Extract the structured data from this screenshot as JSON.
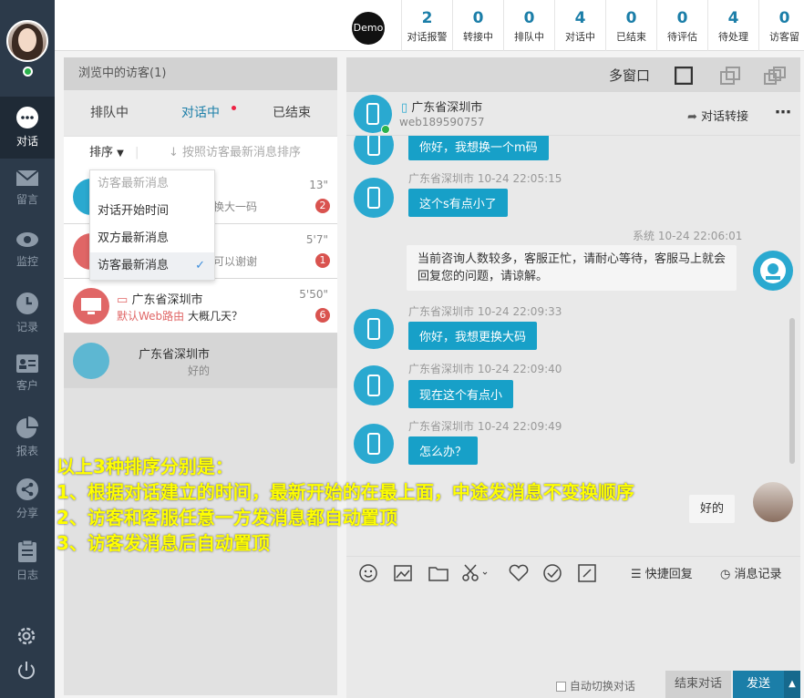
{
  "sidebar": {
    "items": [
      {
        "label": "对话",
        "icon": "chat-bubble-icon",
        "active": true
      },
      {
        "label": "留言",
        "icon": "mail-icon"
      },
      {
        "label": "监控",
        "icon": "eye-icon"
      },
      {
        "label": "记录",
        "icon": "clock-icon"
      },
      {
        "label": "客户",
        "icon": "contact-card-icon"
      },
      {
        "label": "报表",
        "icon": "pie-chart-icon"
      },
      {
        "label": "分享",
        "icon": "share-icon"
      },
      {
        "label": "日志",
        "icon": "clipboard-icon"
      }
    ]
  },
  "topbar": {
    "demo_label": "Demo",
    "stats": [
      {
        "value": "2",
        "label": "对话报警"
      },
      {
        "value": "0",
        "label": "转接中"
      },
      {
        "value": "0",
        "label": "排队中"
      },
      {
        "value": "4",
        "label": "对话中"
      },
      {
        "value": "0",
        "label": "已结束"
      },
      {
        "value": "0",
        "label": "待评估"
      },
      {
        "value": "4",
        "label": "待处理"
      },
      {
        "value": "0",
        "label": "访客留"
      }
    ]
  },
  "left_panel": {
    "title": "浏览中的访客(1)",
    "tabs": [
      "排队中",
      "对话中",
      "已结束"
    ],
    "sort_label": "排序",
    "sort_hint": "按照访客最新消息排序",
    "dropdown": {
      "header": "访客最新消息",
      "options": [
        "对话开始时间",
        "双方最新消息",
        "访客最新消息"
      ],
      "selected": "访客最新消息"
    },
    "visitors": [
      {
        "name": "",
        "msg": "换大一码",
        "time": "13\"",
        "count": "2",
        "color": "#2aa9d0"
      },
      {
        "name": "",
        "msg": "可以谢谢",
        "time": "5'7\"",
        "count": "1",
        "color": "#e06666"
      },
      {
        "name": "广东省深圳市",
        "source": "默认Web路由",
        "msg": "大概几天？",
        "time": "5'50\"",
        "count": "6",
        "color": "#e06666"
      },
      {
        "name": "广东省深圳市",
        "msg": "好的",
        "time": "",
        "count": "",
        "color": "#2aa9d0"
      }
    ]
  },
  "right_panel": {
    "multi_window": "多窗口",
    "visitor_location": "广东省深圳市",
    "visitor_id": "web189590757",
    "transfer": "对话转接",
    "messages": [
      {
        "meta": "",
        "text": "你好，我想换一个m码",
        "side": "visitor"
      },
      {
        "meta": "广东省深圳市 10-24 22:05:15",
        "text": "这个s有点小了",
        "side": "visitor"
      },
      {
        "meta": "系统 10-24 22:06:01",
        "text": "当前咨询人数较多，客服正忙，请耐心等待，客服马上就会回复您的问题，请谅解。",
        "side": "system"
      },
      {
        "meta": "广东省深圳市 10-24 22:09:33",
        "text": "你好，我想更换大码",
        "side": "visitor"
      },
      {
        "meta": "广东省深圳市 10-24 22:09:40",
        "text": "现在这个有点小",
        "side": "visitor"
      },
      {
        "meta": "广东省深圳市 10-24 22:09:49",
        "text": "怎么办？",
        "side": "visitor"
      },
      {
        "meta": "",
        "text": "好的",
        "side": "agent"
      }
    ],
    "quick_reply": "快捷回复",
    "history": "消息记录",
    "auto_switch": "自动切换对话",
    "end_chat": "结束对话",
    "send": "发送"
  },
  "annotation": {
    "lines": [
      "以上3种排序分别是：",
      "1、根据对话建立的时间，最新开始的在最上面，中途发消息不变换顺序",
      "2、访客和客服任意一方发消息都自动置顶",
      "3、访客发消息后自动置顶"
    ]
  }
}
